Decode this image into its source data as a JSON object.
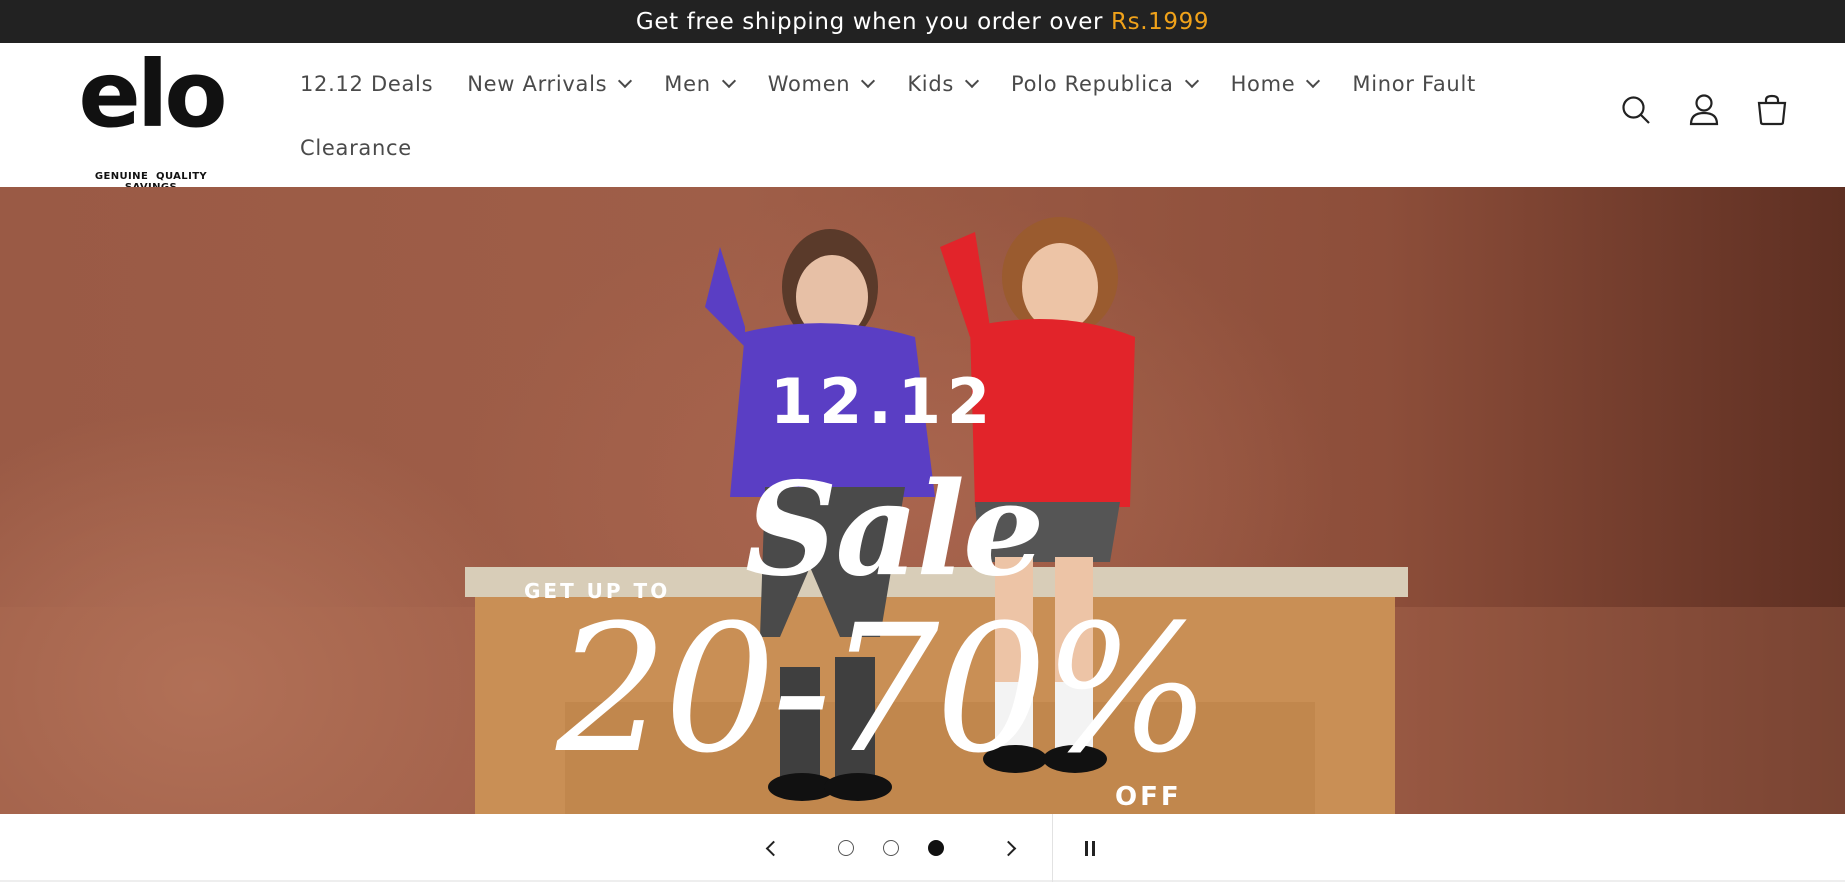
{
  "announcement": {
    "text": "Get free shipping when you order over",
    "highlight": "Rs.1999",
    "highlight_color": "#f0a21a"
  },
  "brand": {
    "wordmark": "elo",
    "tagline": "GENUINE QUALITY SAVINGS"
  },
  "nav": {
    "items": [
      {
        "label": "12.12 Deals",
        "has_dropdown": false
      },
      {
        "label": "New Arrivals",
        "has_dropdown": true
      },
      {
        "label": "Men",
        "has_dropdown": true
      },
      {
        "label": "Women",
        "has_dropdown": true
      },
      {
        "label": "Kids",
        "has_dropdown": true
      },
      {
        "label": "Polo Republica",
        "has_dropdown": true
      },
      {
        "label": "Home",
        "has_dropdown": true
      },
      {
        "label": "Minor Fault",
        "has_dropdown": false
      },
      {
        "label": "Clearance",
        "has_dropdown": false
      }
    ]
  },
  "header_icons": [
    "search-icon",
    "account-icon",
    "cart-icon"
  ],
  "hero": {
    "line1": "12.12",
    "line2": "Sale",
    "line3": "GET UP TO",
    "line4": "20-70%",
    "line5": "OFF",
    "background_color": "#9f5e48"
  },
  "slider": {
    "slide_count": 3,
    "active_slide": 3,
    "controls": [
      "chevron-left-icon",
      "chevron-right-icon",
      "pause-icon"
    ]
  }
}
